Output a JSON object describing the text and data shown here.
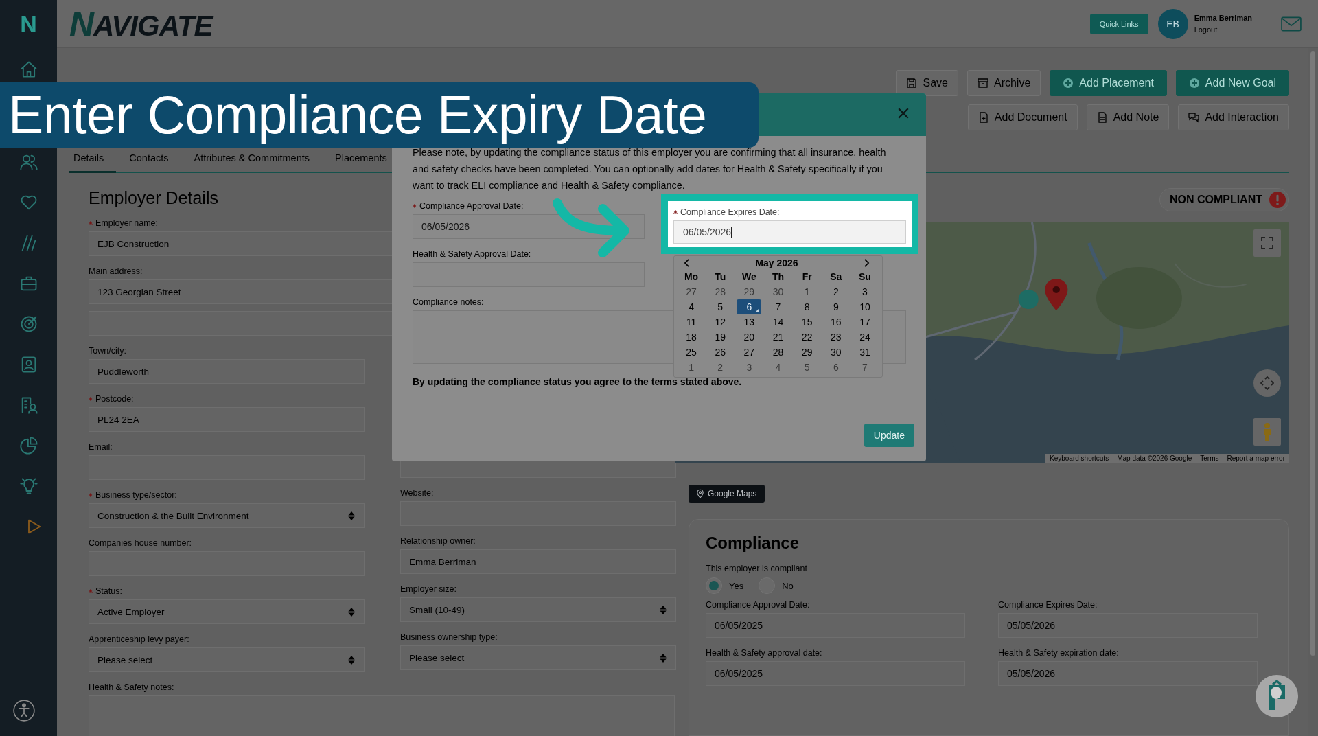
{
  "sidebar": {
    "logo": "N"
  },
  "header": {
    "logo": "NAVIGATE",
    "quick_links": "Quick Links",
    "user": {
      "initials": "EB",
      "name": "Emma Berriman",
      "logout": "Logout"
    }
  },
  "toolbar": {
    "row_1": [
      {
        "label": "Save",
        "kind": "save"
      },
      {
        "label": "Archive",
        "kind": "archive"
      },
      {
        "label": "Add Placement",
        "kind": "add"
      },
      {
        "label": "Add New Goal",
        "kind": "add"
      }
    ],
    "row_2": [
      {
        "label": "Add Document",
        "kind": "document"
      },
      {
        "label": "Add Note",
        "kind": "note"
      },
      {
        "label": "Add Interaction",
        "kind": "interaction"
      }
    ]
  },
  "tabs": [
    {
      "label": "Details",
      "selected": true
    },
    {
      "label": "Contacts",
      "selected": false
    },
    {
      "label": "Attributes & Commitments",
      "selected": false
    },
    {
      "label": "Placements",
      "selected": false
    }
  ],
  "employer_details": {
    "title": "Employer Details",
    "fields_top": [
      {
        "label": "Employer name:",
        "required": true,
        "value": "EJB Construction",
        "kind": "text"
      },
      {
        "label": "Main address:",
        "required": false,
        "value": "123 Georgian Street",
        "kind": "text"
      },
      {
        "required": false,
        "kind": "text"
      }
    ],
    "fields_left": [
      {
        "label": "Town/city:",
        "required": false,
        "value": "Puddleworth",
        "kind": "text"
      },
      {
        "label": "Postcode:",
        "required": true,
        "value": "PL24 2EA",
        "kind": "text"
      },
      {
        "label": "Email:",
        "required": false,
        "kind": "text"
      },
      {
        "label": "Business type/sector:",
        "required": true,
        "value": "Construction & the Built Environment",
        "kind": "select"
      },
      {
        "label": "Companies house number:",
        "required": false,
        "kind": "text"
      },
      {
        "label": "Status:",
        "required": true,
        "value": "Active Employer",
        "kind": "select"
      },
      {
        "label": "Apprenticeship levy payer:",
        "required": false,
        "value": "Please select",
        "kind": "select"
      }
    ],
    "fields_right": [
      {
        "required": false,
        "kind": "text"
      },
      {
        "label": "Website:",
        "required": false,
        "kind": "text"
      },
      {
        "label": "Relationship owner:",
        "required": false,
        "value": "Emma Berriman",
        "kind": "text"
      },
      {
        "label": "Employer size:",
        "required": false,
        "value": "Small (10-49)",
        "kind": "select"
      },
      {
        "label": "Business ownership type:",
        "required": false,
        "value": "Please select",
        "kind": "select"
      }
    ],
    "notes_label": "Health & Safety notes:"
  },
  "status_badge": "NON COMPLIANT",
  "map": {
    "attribution": [
      "Keyboard shortcuts",
      "Map data ©2026 Google",
      "Terms",
      "Report a map error"
    ],
    "button": "Google Maps"
  },
  "compliance": {
    "title": "Compliance",
    "question": "This employer is compliant",
    "radios": [
      {
        "label": "Yes",
        "selected": true
      },
      {
        "label": "No",
        "selected": false
      }
    ],
    "fields": [
      {
        "label": "Compliance Approval Date:",
        "value": "06/05/2025"
      },
      {
        "label": "Compliance Expires Date:",
        "value": "05/05/2026"
      },
      {
        "label": "Health & Safety approval date:",
        "value": "06/05/2025"
      },
      {
        "label": "Health & Safety expiration date:",
        "value": "05/05/2026"
      }
    ]
  },
  "modal": {
    "intro": "Please note, by updating the compliance status of this employer you are confirming that all insurance, health and safety checks have been completed. You can optionally add dates for Health & Safety specifically if you want to track ELI compliance and Health & Safety compliance.",
    "approval": {
      "label": "Compliance Approval Date:",
      "required": true,
      "value": "06/05/2026"
    },
    "hs_approval": {
      "label": "Health & Safety Approval Date:",
      "required": false
    },
    "notes_label": "Compliance notes:",
    "agreement": "By updating the compliance status you agree to the terms stated above.",
    "update": "Update",
    "calendar": {
      "month": "May 2026",
      "weekdays": [
        "Mo",
        "Tu",
        "We",
        "Th",
        "Fr",
        "Sa",
        "Su"
      ],
      "weeks": [
        [
          {
            "day": "27",
            "outside": true,
            "selected": false
          },
          {
            "day": "28",
            "outside": true,
            "selected": false
          },
          {
            "day": "29",
            "outside": true,
            "selected": false
          },
          {
            "day": "30",
            "outside": true,
            "selected": false
          },
          {
            "day": "1",
            "outside": false,
            "selected": false
          },
          {
            "day": "2",
            "outside": false,
            "selected": false
          },
          {
            "day": "3",
            "outside": false,
            "selected": false
          }
        ],
        [
          {
            "day": "4",
            "outside": false,
            "selected": false
          },
          {
            "day": "5",
            "outside": false,
            "selected": false
          },
          {
            "day": "6",
            "outside": false,
            "selected": true
          },
          {
            "day": "7",
            "outside": false,
            "selected": false
          },
          {
            "day": "8",
            "outside": false,
            "selected": false
          },
          {
            "day": "9",
            "outside": false,
            "selected": false
          },
          {
            "day": "10",
            "outside": false,
            "selected": false
          }
        ],
        [
          {
            "day": "11",
            "outside": false,
            "selected": false
          },
          {
            "day": "12",
            "outside": false,
            "selected": false
          },
          {
            "day": "13",
            "outside": false,
            "selected": false
          },
          {
            "day": "14",
            "outside": false,
            "selected": false
          },
          {
            "day": "15",
            "outside": false,
            "selected": false
          },
          {
            "day": "16",
            "outside": false,
            "selected": false
          },
          {
            "day": "17",
            "outside": false,
            "selected": false
          }
        ],
        [
          {
            "day": "18",
            "outside": false,
            "selected": false
          },
          {
            "day": "19",
            "outside": false,
            "selected": false
          },
          {
            "day": "20",
            "outside": false,
            "selected": false
          },
          {
            "day": "21",
            "outside": false,
            "selected": false
          },
          {
            "day": "22",
            "outside": false,
            "selected": false
          },
          {
            "day": "23",
            "outside": false,
            "selected": false
          },
          {
            "day": "24",
            "outside": false,
            "selected": false
          }
        ],
        [
          {
            "day": "25",
            "outside": false,
            "selected": false
          },
          {
            "day": "26",
            "outside": false,
            "selected": false
          },
          {
            "day": "27",
            "outside": false,
            "selected": false
          },
          {
            "day": "28",
            "outside": false,
            "selected": false
          },
          {
            "day": "29",
            "outside": false,
            "selected": false
          },
          {
            "day": "30",
            "outside": false,
            "selected": false
          },
          {
            "day": "31",
            "outside": false,
            "selected": false
          }
        ],
        [
          {
            "day": "1",
            "outside": true,
            "selected": false
          },
          {
            "day": "2",
            "outside": true,
            "selected": false
          },
          {
            "day": "3",
            "outside": true,
            "selected": false
          },
          {
            "day": "4",
            "outside": true,
            "selected": false
          },
          {
            "day": "5",
            "outside": true,
            "selected": false
          },
          {
            "day": "6",
            "outside": true,
            "selected": false
          },
          {
            "day": "7",
            "outside": true,
            "selected": false
          }
        ]
      ]
    }
  },
  "highlight": {
    "label": "Compliance Expires Date:",
    "required": true,
    "value": "06/05/2026"
  },
  "banner": "Enter Compliance Expiry Date"
}
